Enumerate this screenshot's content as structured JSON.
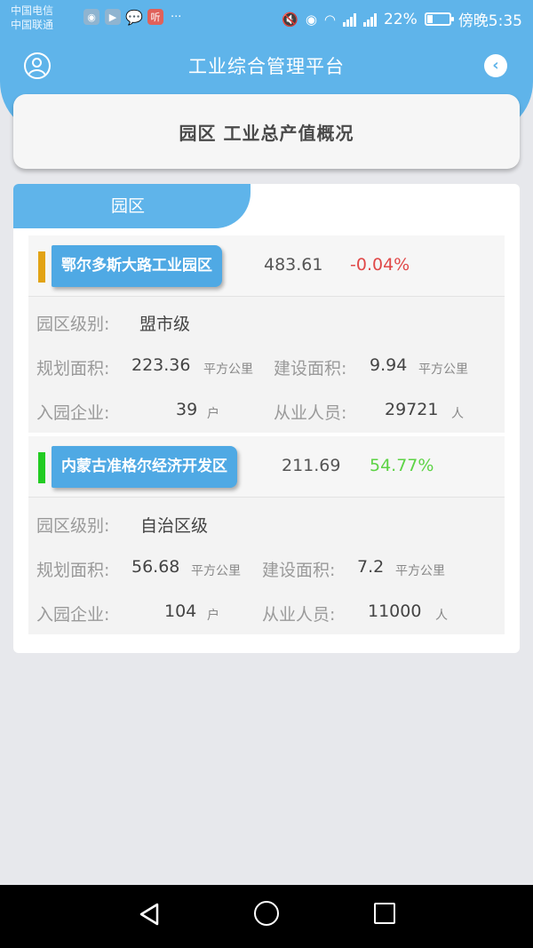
{
  "status_bar": {
    "carrier_1": "中国电信",
    "carrier_2": "中国联通",
    "notif_icon_label": "听",
    "more": "···",
    "battery_percent": "22%",
    "time": "傍晚5:35"
  },
  "header": {
    "title": "工业综合管理平台"
  },
  "page": {
    "title": "园区 工业总产值概况"
  },
  "list": {
    "tab_label": "园区",
    "parks": [
      {
        "name": "鄂尔多斯大路工业园区",
        "value": "483.61",
        "change": "-0.04%",
        "change_color": "#e04848",
        "marker_color": "#e2a315",
        "level_label": "园区级别:",
        "level": "盟市级",
        "planned_area_label": "规划面积:",
        "planned_area": "223.36",
        "planned_area_unit": "平方公里",
        "built_area_label": "建设面积:",
        "built_area": "9.94",
        "built_area_unit": "平方公里",
        "enterprises_label": "入园企业:",
        "enterprises": "39",
        "enterprises_unit": "户",
        "employees_label": "从业人员:",
        "employees": "29721",
        "employees_unit": "人"
      },
      {
        "name": "内蒙古准格尔经济开发区",
        "value": "211.69",
        "change": "54.77%",
        "change_color": "#5dd345",
        "marker_color": "#22cc22",
        "level_label": "园区级别:",
        "level": "自治区级",
        "planned_area_label": "规划面积:",
        "planned_area": "56.68",
        "planned_area_unit": "平方公里",
        "built_area_label": "建设面积:",
        "built_area": "7.2",
        "built_area_unit": "平方公里",
        "enterprises_label": "入园企业:",
        "enterprises": "104",
        "enterprises_unit": "户",
        "employees_label": "从业人员:",
        "employees": "11000",
        "employees_unit": "人"
      }
    ]
  },
  "icons": {
    "user": "user-icon",
    "back": "back-chevron-icon",
    "nav_back": "nav-back-icon",
    "nav_home": "nav-home-icon",
    "nav_recent": "nav-recent-apps-icon"
  },
  "colors": {
    "primary": "#5fb4ea",
    "name_tag": "#4fa9e4",
    "background": "#e7e8ec"
  }
}
